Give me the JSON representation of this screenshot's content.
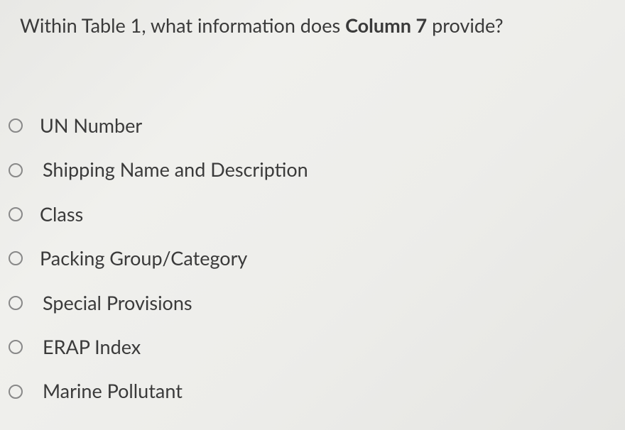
{
  "question": {
    "prefix": "Within Table 1, what information does ",
    "bold": "Column 7",
    "suffix": " provide?"
  },
  "options": [
    {
      "label": "UN Number"
    },
    {
      "label": "Shipping Name and Description"
    },
    {
      "label": "Class"
    },
    {
      "label": "Packing Group/Category"
    },
    {
      "label": "Special Provisions"
    },
    {
      "label": "ERAP Index"
    },
    {
      "label": "Marine Pollutant"
    }
  ]
}
